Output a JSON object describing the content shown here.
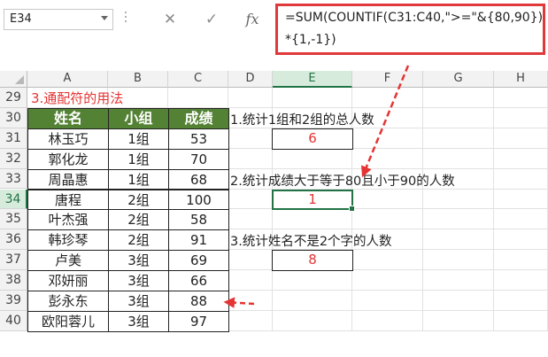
{
  "formula_bar": {
    "name_box": "E34",
    "cancel_icon": "✕",
    "enter_icon": "✓",
    "fx_label": "fx",
    "formula_line1": "=SUM(COUNTIF(C31:C40,\">=\"&{80,90})",
    "formula_line2": "*{1,-1})"
  },
  "columns": [
    "A",
    "B",
    "C",
    "D",
    "E",
    "F",
    "G",
    "H"
  ],
  "selected_column": "E",
  "rows": [
    "29",
    "30",
    "31",
    "32",
    "33",
    "34",
    "35",
    "36",
    "37",
    "38",
    "39",
    "40"
  ],
  "selected_row": "34",
  "section_title": "3.通配符的用法",
  "table": {
    "headers": [
      "姓名",
      "小组",
      "成绩"
    ],
    "rows": [
      [
        "林玉巧",
        "1组",
        "53"
      ],
      [
        "郭化龙",
        "1组",
        "70"
      ],
      [
        "周晶惠",
        "1组",
        "68"
      ],
      [
        "唐程",
        "2组",
        "100"
      ],
      [
        "叶杰强",
        "2组",
        "58"
      ],
      [
        "韩珍琴",
        "2组",
        "91"
      ],
      [
        "卢美",
        "3组",
        "69"
      ],
      [
        "邓妍丽",
        "3组",
        "66"
      ],
      [
        "彭永东",
        "3组",
        "88"
      ],
      [
        "欧阳蓉儿",
        "3组",
        "97"
      ]
    ]
  },
  "questions": [
    {
      "text": "1.统计1组和2组的总人数",
      "answer": "6"
    },
    {
      "text": "2.统计成绩大于等于80且小于90的人数",
      "answer": "1"
    },
    {
      "text": "3.统计姓名不是2个字的人数",
      "answer": "8"
    }
  ],
  "colors": {
    "accent_red": "#e53434",
    "header_green": "#548235",
    "excel_green": "#217346"
  }
}
